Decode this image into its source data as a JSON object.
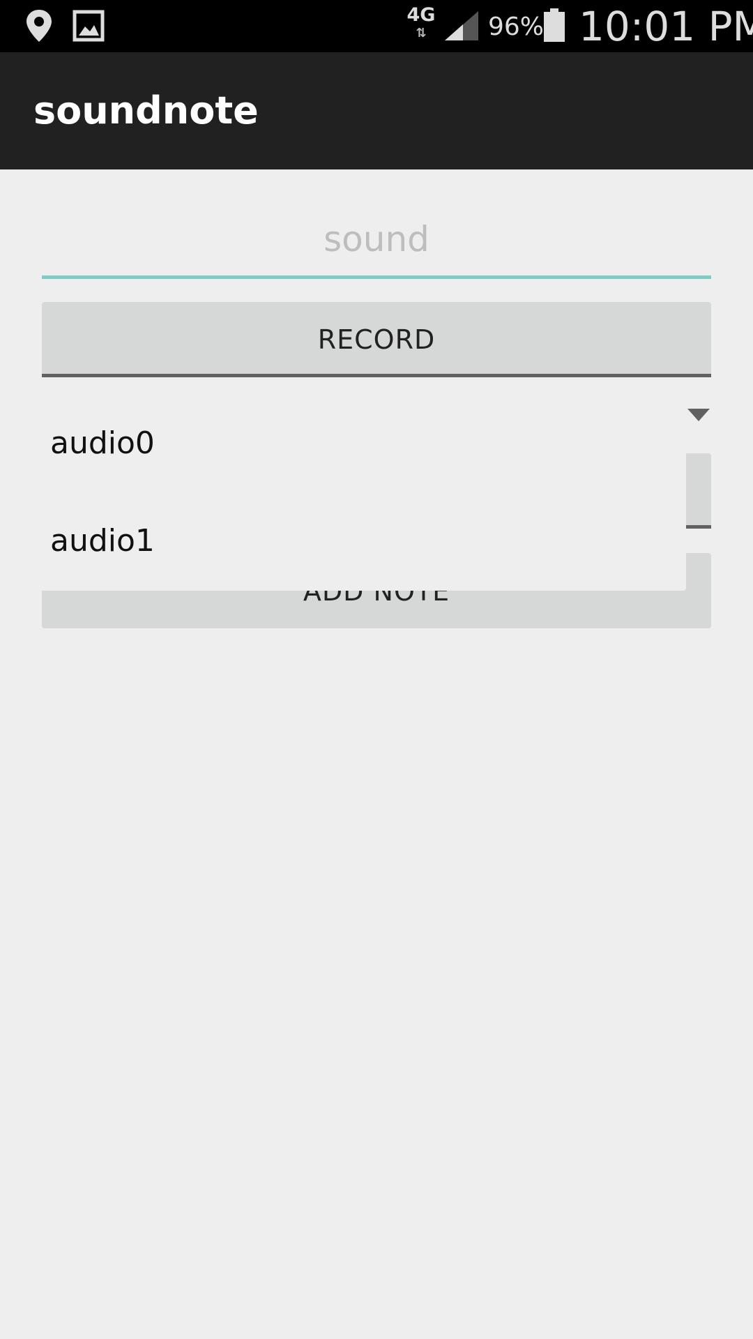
{
  "status_bar": {
    "network": "4G",
    "battery_percent": "96%",
    "time": "10:01 PM",
    "icons": [
      "location-icon",
      "gallery-icon",
      "data-transfer-icon",
      "signal-icon",
      "battery-icon"
    ]
  },
  "app_bar": {
    "title": "soundnote"
  },
  "main": {
    "sound_input": {
      "value": "",
      "placeholder": "sound"
    },
    "record_button_label": "RECORD",
    "add_note_button_label": "ADD NOTE",
    "spinner": {
      "options": [
        "audio0",
        "audio1"
      ]
    }
  },
  "colors": {
    "status_bar": "#000000",
    "app_bar": "#212121",
    "background": "#eeeeee",
    "input_underline": "#80cbc4",
    "button": "#d6d7d7"
  }
}
